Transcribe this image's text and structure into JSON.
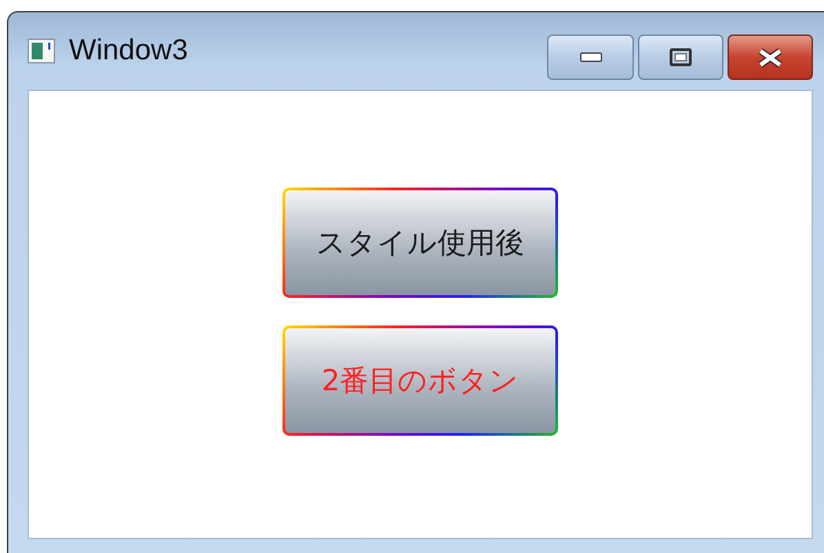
{
  "window": {
    "title": "Window3"
  },
  "buttons": [
    {
      "label": "スタイル使用後",
      "color": "#1a1a1a"
    },
    {
      "label": "2番目のボタン",
      "color": "#ff2020"
    }
  ]
}
